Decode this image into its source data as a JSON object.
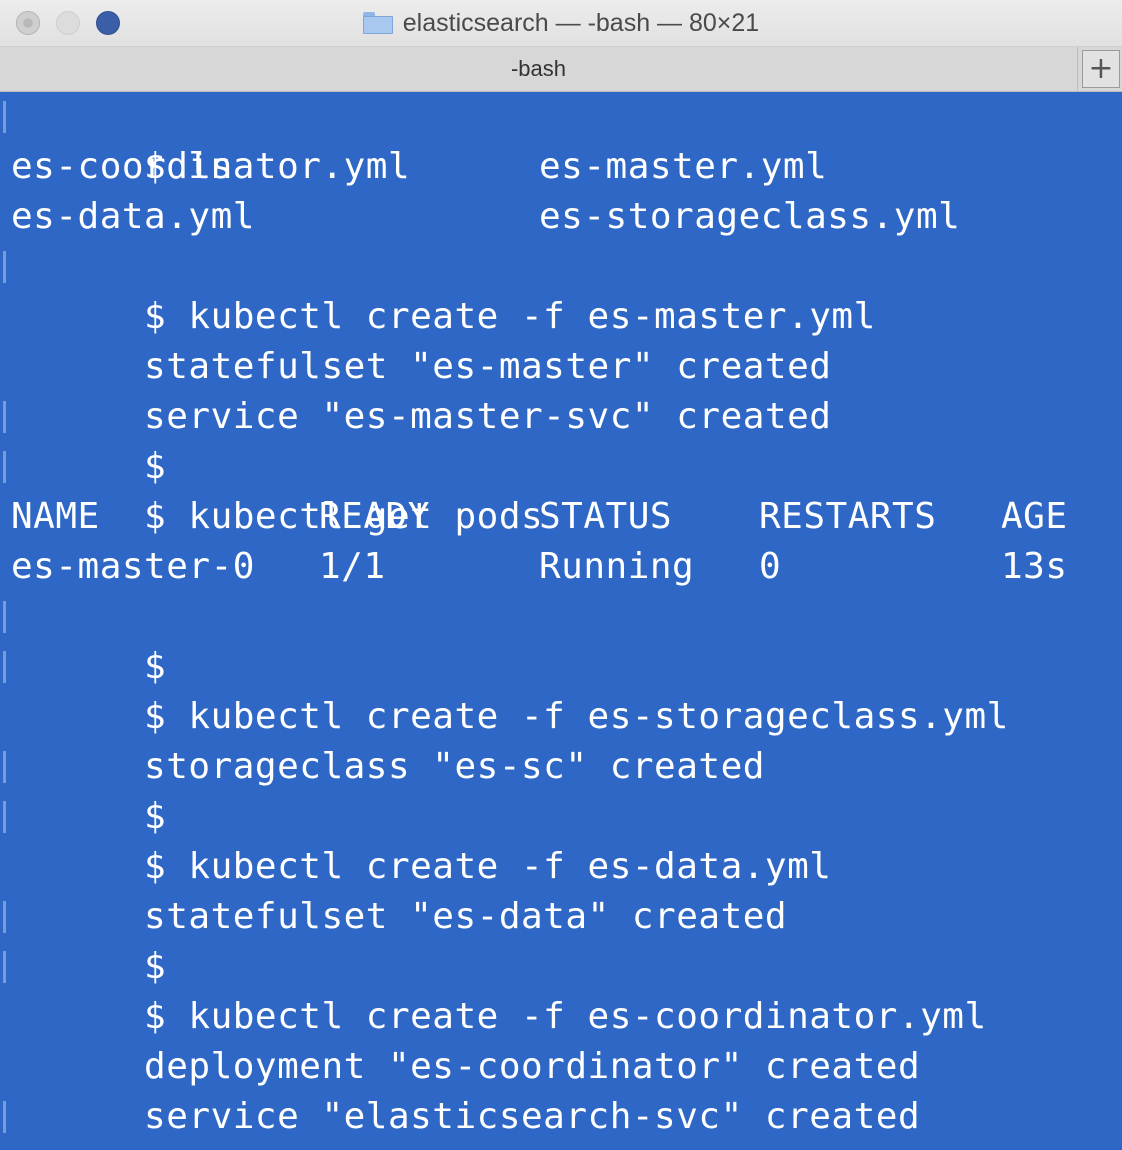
{
  "window": {
    "title": "elasticsearch — -bash — 80×21",
    "tab_label": "-bash",
    "new_tab_glyph": "+",
    "background_color": "#2f67c6",
    "text_color": "#ffffff"
  },
  "terminal": {
    "lines": [
      "$ ls",
      "",
      "",
      "$ kubectl create -f es-master.yml",
      "statefulset \"es-master\" created",
      "service \"es-master-svc\" created",
      "$",
      "$ kubectl get pods",
      "",
      "",
      "$",
      "$ kubectl create -f es-storageclass.yml",
      "storageclass \"es-sc\" created",
      "$",
      "$ kubectl create -f es-data.yml",
      "statefulset \"es-data\" created",
      "$",
      "$ kubectl create -f es-coordinator.yml",
      "deployment \"es-coordinator\" created",
      "service \"elasticsearch-svc\" created",
      "$"
    ],
    "ls_output": [
      [
        "es-coordinator.yml",
        "es-master.yml"
      ],
      [
        "es-data.yml",
        "es-storageclass.yml"
      ]
    ],
    "pods_table": {
      "headers": [
        "NAME",
        "READY",
        "STATUS",
        "RESTARTS",
        "AGE"
      ],
      "rows": [
        [
          "es-master-0",
          "1/1",
          "Running",
          "0",
          "13s"
        ]
      ]
    }
  }
}
